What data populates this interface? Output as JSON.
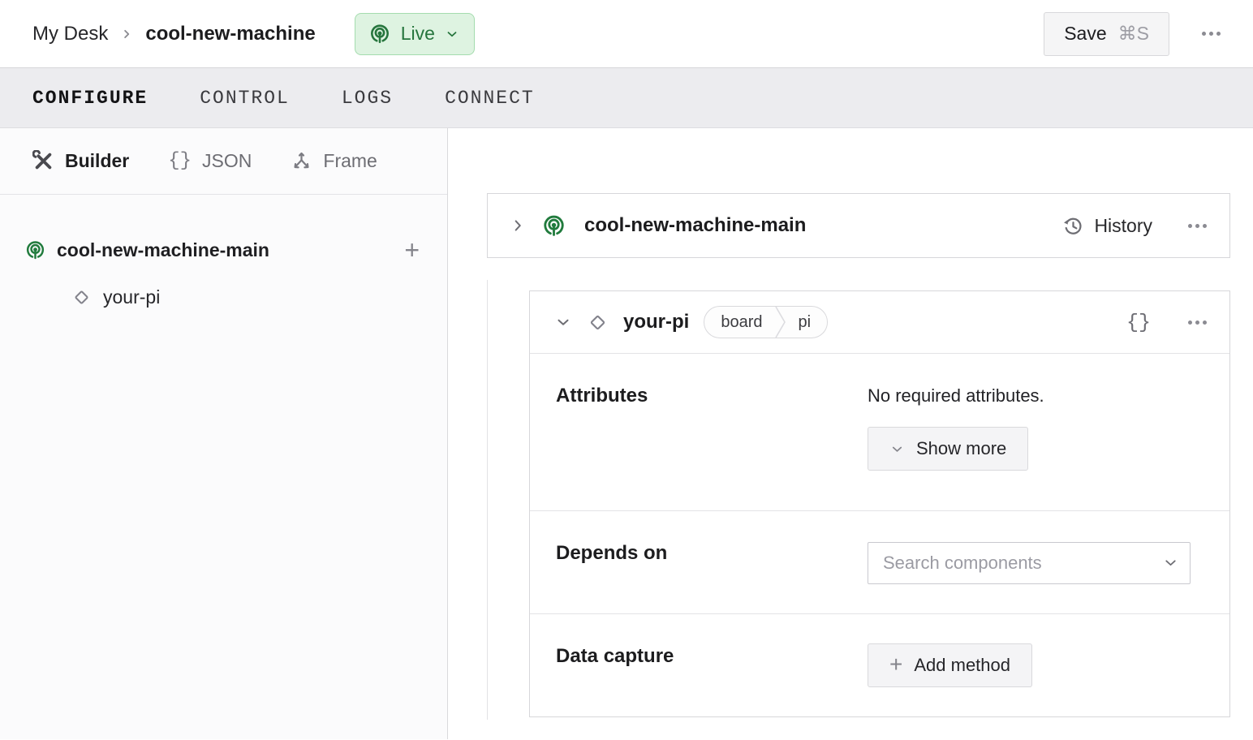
{
  "header": {
    "breadcrumb": {
      "parent": "My Desk",
      "current": "cool-new-machine"
    },
    "live": {
      "label": "Live"
    },
    "save": {
      "label": "Save",
      "shortcut": "⌘S"
    }
  },
  "tabs": [
    {
      "label": "CONFIGURE",
      "active": true
    },
    {
      "label": "CONTROL",
      "active": false
    },
    {
      "label": "LOGS",
      "active": false
    },
    {
      "label": "CONNECT",
      "active": false
    }
  ],
  "sidebar": {
    "modes": [
      {
        "label": "Builder",
        "active": true
      },
      {
        "label": "JSON",
        "active": false
      },
      {
        "label": "Frame",
        "active": false
      }
    ],
    "tree": {
      "root": {
        "name": "cool-new-machine-main"
      },
      "children": [
        {
          "name": "your-pi"
        }
      ]
    }
  },
  "main": {
    "part_card": {
      "title": "cool-new-machine-main",
      "history_label": "History"
    },
    "component_card": {
      "title": "your-pi",
      "badge": {
        "type": "board",
        "model": "pi"
      },
      "json_toggle": "{}",
      "sections": {
        "attributes": {
          "label": "Attributes",
          "empty_text": "No required attributes.",
          "show_more_label": "Show more"
        },
        "depends_on": {
          "label": "Depends on",
          "search_placeholder": "Search components"
        },
        "data_capture": {
          "label": "Data capture",
          "add_method_label": "Add method"
        }
      }
    }
  },
  "icons": {
    "plus": "+",
    "json_braces": "{}"
  },
  "colors": {
    "live_bg": "#def3e1",
    "live_border": "#a4dcae",
    "live_text": "#26753d",
    "brand_green": "#217b3d",
    "tabbar_bg": "#ececef",
    "card_border": "#d7d7da",
    "button_bg": "#f4f4f6",
    "muted_gray": "#85858c",
    "text_dark": "#1c1c1e"
  }
}
